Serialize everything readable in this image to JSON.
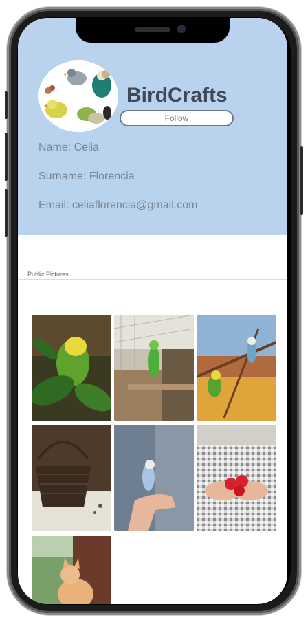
{
  "profile": {
    "brand": "BirdCrafts",
    "follow_label": "Follow",
    "name_line": "Name: Celia",
    "surname_line": "Surname: Florencia",
    "email_line": "Email: celiaflorencia@gmail.com"
  },
  "gallery": {
    "section_label": "Public Pictures",
    "photos": [
      "parakeet-in-leaves",
      "parakeet-in-cage",
      "birds-on-branch",
      "basket",
      "parakeet-on-hand",
      "hands-with-strawberries",
      "cat-at-window"
    ]
  },
  "colors": {
    "header_bg": "#b9d2ee",
    "brand_text": "#3e4856",
    "info_text": "#7a8594"
  }
}
